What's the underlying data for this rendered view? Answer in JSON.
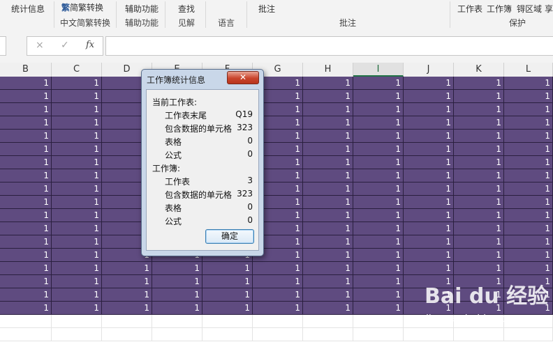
{
  "ribbon": {
    "items": [
      {
        "label": "统计信息"
      },
      {
        "label": "简繁转换"
      },
      {
        "label": "辅助功能"
      },
      {
        "label": "查找"
      },
      {
        "label": "批注"
      },
      {
        "label": "工作表"
      },
      {
        "label": "工作簿"
      },
      {
        "label": "锝区域"
      },
      {
        "label": "享"
      }
    ],
    "groups": [
      {
        "label": "中文简繁转换"
      },
      {
        "label": "辅助功能"
      },
      {
        "label": "见解"
      },
      {
        "label": "语言"
      },
      {
        "label": "批注"
      },
      {
        "label": "保护"
      }
    ]
  },
  "formula_bar": {
    "cancel_icon": "×",
    "enter_icon": "✓",
    "fx_label": "fx",
    "value": ""
  },
  "columns": [
    "B",
    "C",
    "D",
    "E",
    "F",
    "G",
    "H",
    "I",
    "J",
    "K",
    "L"
  ],
  "active_column": "I",
  "cell_value": "1",
  "dialog": {
    "title": "工作簿统计信息",
    "close_icon": "✕",
    "current_sheet_heading": "当前工作表:",
    "current_sheet": [
      {
        "label": "工作表末尾",
        "value": "Q19"
      },
      {
        "label": "包含数据的单元格",
        "value": "323"
      },
      {
        "label": "表格",
        "value": "0"
      },
      {
        "label": "公式",
        "value": "0"
      }
    ],
    "workbook_heading": "工作簿:",
    "workbook": [
      {
        "label": "工作表",
        "value": "3"
      },
      {
        "label": "包含数据的单元格",
        "value": "323"
      },
      {
        "label": "表格",
        "value": "0"
      },
      {
        "label": "公式",
        "value": "0"
      }
    ],
    "ok_label": "确定"
  },
  "watermark": {
    "logo": "Bai du 经验",
    "url": "jingyan.baidu.com"
  },
  "colors": {
    "cell_fill": "#5f4b80",
    "dialog_frame": "#c9d7e9",
    "close_button": "#c9442c"
  }
}
